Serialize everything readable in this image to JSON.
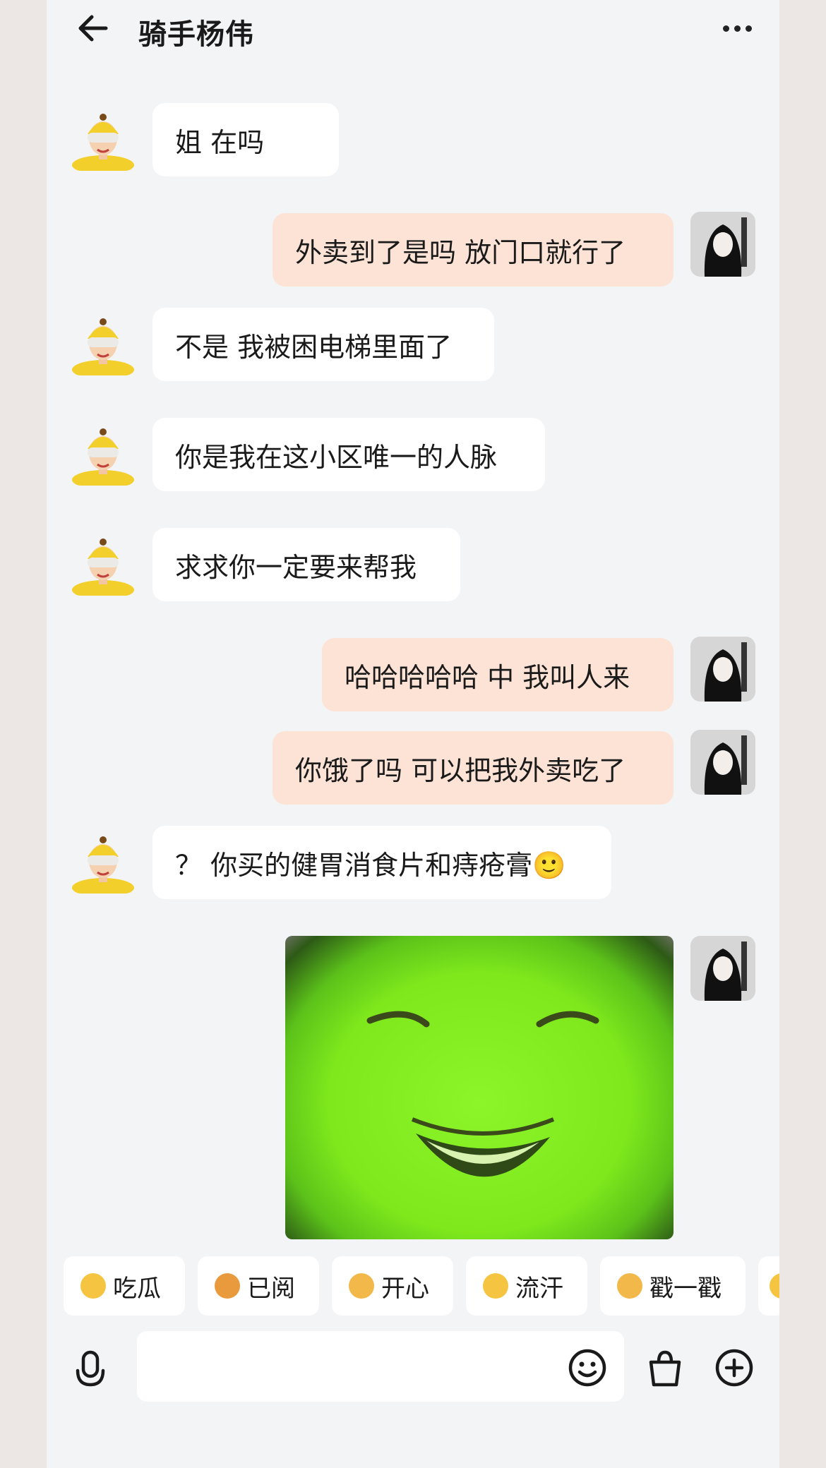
{
  "header": {
    "title": "骑手杨伟"
  },
  "messages": [
    {
      "side": "in",
      "text": "姐 在吗"
    },
    {
      "side": "out",
      "text": "外卖到了是吗 放门口就行了"
    },
    {
      "side": "in",
      "text": "不是 我被困电梯里面了"
    },
    {
      "side": "in",
      "text": "你是我在这小区唯一的人脉"
    },
    {
      "side": "in",
      "text": "求求你一定要来帮我"
    },
    {
      "side": "out",
      "text": "哈哈哈哈哈 中 我叫人来"
    },
    {
      "side": "out",
      "text": "你饿了吗 可以把我外卖吃了"
    },
    {
      "side": "in",
      "text": "？ 你买的健胃消食片和痔疮膏🙂"
    },
    {
      "side": "out",
      "type": "image",
      "description_icon": "green-face-sticker"
    }
  ],
  "quick_replies": [
    {
      "label": "吃瓜",
      "icon": "melon-emoji-icon"
    },
    {
      "label": "已阅",
      "icon": "read-emoji-icon"
    },
    {
      "label": "开心",
      "icon": "happy-emoji-icon"
    },
    {
      "label": "流汗",
      "icon": "sweat-emoji-icon"
    },
    {
      "label": "戳一戳",
      "icon": "poke-emoji-icon"
    }
  ],
  "input": {
    "placeholder": ""
  },
  "colors": {
    "incoming_bubble": "#ffffff",
    "outgoing_bubble": "#fde3d6",
    "badge": "#f4511e"
  }
}
